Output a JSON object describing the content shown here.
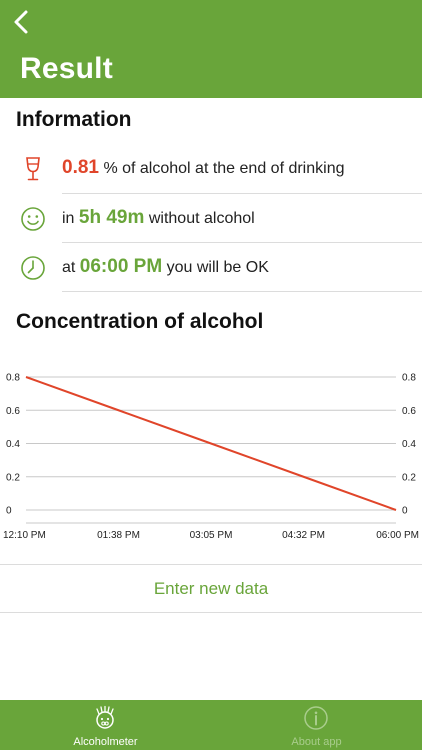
{
  "header": {
    "title": "Result"
  },
  "info": {
    "title": "Information",
    "rows": [
      {
        "value": "0.81",
        "suffix": "% of alcohol at the end of drinking"
      },
      {
        "prefix": "in",
        "value": "5h 49m",
        "suffix": "without alcohol"
      },
      {
        "prefix": "at",
        "value": "06:00 PM",
        "suffix": "you will be OK"
      }
    ]
  },
  "chart_section": {
    "title": "Concentration of alcohol"
  },
  "chart_data": {
    "type": "line",
    "x": [
      "12:10 PM",
      "01:38 PM",
      "03:05 PM",
      "04:32 PM",
      "06:00 PM"
    ],
    "y_ticks": [
      "0.8",
      "0.6",
      "0.4",
      "0.2",
      "0"
    ],
    "ylim": [
      0,
      0.8
    ],
    "grid": true,
    "series": [
      {
        "values": [
          0.8,
          0.6,
          0.4,
          0.2,
          0
        ],
        "color": "#e0452a"
      }
    ]
  },
  "actions": {
    "enter_new_data": "Enter new data"
  },
  "tabs": [
    {
      "label": "Alcoholmeter",
      "active": true
    },
    {
      "label": "About app",
      "active": false
    }
  ],
  "colors": {
    "brand": "#69a53a",
    "accent_red": "#e0452a",
    "tab_inactive": "#a9cd8c"
  }
}
